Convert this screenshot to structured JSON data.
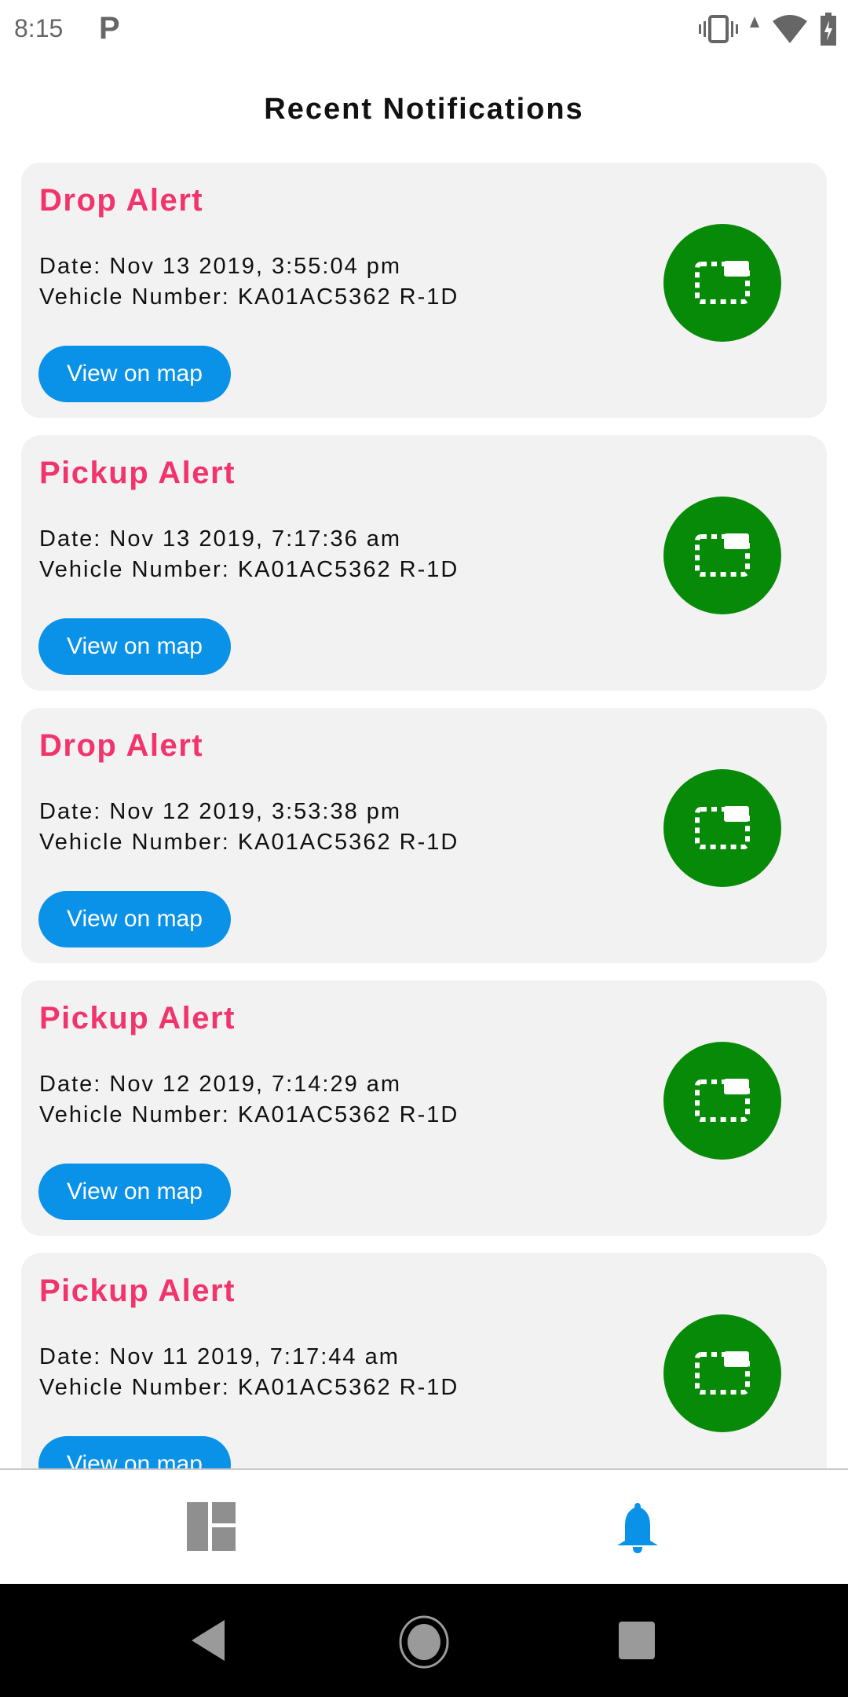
{
  "status_bar": {
    "time": "8:15",
    "app_icon": "P",
    "icons": [
      "vibrate-icon",
      "signal-icon",
      "wifi-icon",
      "battery-charging-icon"
    ]
  },
  "header": {
    "title": "Recent Notifications"
  },
  "colors": {
    "alert_title": "#f2346d",
    "button": "#0a92e8",
    "icon_circle": "#078a07",
    "active_nav": "#0a92e8",
    "inactive_nav": "#8f8f8f"
  },
  "notifications": [
    {
      "title": "Drop Alert",
      "date": "Date: Nov 13 2019, 3:55:04 pm",
      "vehicle": "Vehicle Number: KA01AC5362 R-1D",
      "button": "View on map"
    },
    {
      "title": "Pickup Alert",
      "date": "Date: Nov 13 2019, 7:17:36 am",
      "vehicle": "Vehicle Number: KA01AC5362 R-1D",
      "button": "View on map"
    },
    {
      "title": "Drop Alert",
      "date": "Date: Nov 12 2019, 3:53:38 pm",
      "vehicle": "Vehicle Number: KA01AC5362 R-1D",
      "button": "View on map"
    },
    {
      "title": "Pickup Alert",
      "date": "Date: Nov 12 2019, 7:14:29 am",
      "vehicle": "Vehicle Number: KA01AC5362 R-1D",
      "button": "View on map"
    },
    {
      "title": "Pickup Alert",
      "date": "Date: Nov 11 2019, 7:17:44 am",
      "vehicle": "Vehicle Number: KA01AC5362 R-1D",
      "button": "View on map"
    }
  ],
  "bottom_nav": {
    "items": [
      {
        "icon": "dashboard-icon",
        "active": false
      },
      {
        "icon": "bell-icon",
        "active": true
      }
    ]
  },
  "system_nav": [
    "back-icon",
    "home-icon",
    "recents-icon"
  ]
}
